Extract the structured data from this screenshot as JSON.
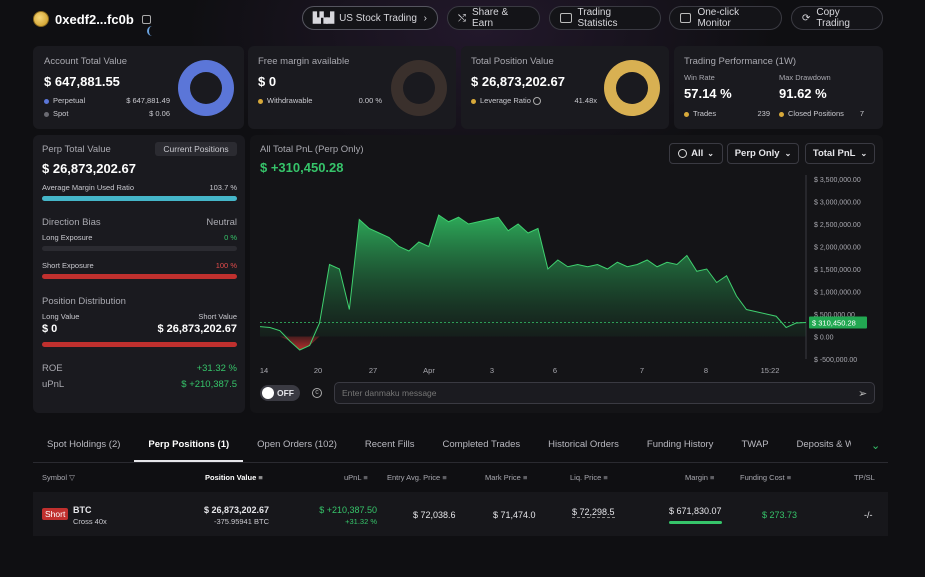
{
  "wallet": {
    "address": "0xedf2...fc0b"
  },
  "nav": {
    "us_stock": "US Stock Trading",
    "share": "Share & Earn",
    "stats": "Trading Statistics",
    "monitor": "One-click Monitor",
    "copy": "Copy Trading"
  },
  "account": {
    "title": "Account Total Value",
    "value": "$ 647,881.55",
    "perp_label": "Perpetual",
    "perp_value": "$ 647,881.49",
    "spot_label": "Spot",
    "spot_value": "$ 0.06"
  },
  "margin": {
    "title": "Free margin available",
    "value": "$ 0",
    "withdrawable_label": "Withdrawable",
    "withdrawable_value": "0.00 %"
  },
  "position": {
    "title": "Total Position Value",
    "value": "$ 26,873,202.67",
    "leverage_label": "Leverage Ratio",
    "leverage_value": "41.48x"
  },
  "performance": {
    "title": "Trading Performance (1W)",
    "win_rate_label": "Win Rate",
    "win_rate": "57.14 %",
    "drawdown_label": "Max Drawdown",
    "drawdown": "91.62 %",
    "trades_label": "Trades",
    "trades": "239",
    "closed_label": "Closed Positions",
    "closed": "7"
  },
  "perp": {
    "title": "Perp Total Value",
    "current_btn": "Current Positions",
    "value": "$ 26,873,202.67",
    "avg_margin_label": "Average Margin Used Ratio",
    "avg_margin_value": "103.7 %",
    "avg_margin_fill": 1.0,
    "bias_label": "Direction Bias",
    "bias_value": "Neutral",
    "long_exp_label": "Long Exposure",
    "long_exp_value": "0 %",
    "short_exp_label": "Short Exposure",
    "short_exp_value": "100 %",
    "dist_label": "Position Distribution",
    "long_value_label": "Long Value",
    "short_value_label": "Short Value",
    "long_value": "$ 0",
    "short_value": "$ 26,873,202.67",
    "roe_label": "ROE",
    "roe_value": "+31.32 %",
    "upnl_label": "uPnL",
    "upnl_value": "$ +210,387.5"
  },
  "pnl": {
    "title": "All Total PnL (Perp Only)",
    "value": "$ +310,450.28",
    "filter_all": "All",
    "filter_perp": "Perp Only",
    "filter_total": "Total PnL",
    "current_tag": "$ 310,450.28",
    "toggle": "OFF",
    "danmaku_placeholder": "Enter danmaku message"
  },
  "chart_data": {
    "type": "area",
    "title": "All Total PnL (Perp Only)",
    "x_ticks": [
      "14",
      "20",
      "27",
      "Apr",
      "3",
      "6",
      "7",
      "8",
      "15:22"
    ],
    "y_ticks": [
      "$ 3,500,000.00",
      "$ 3,000,000.00",
      "$ 2,500,000.00",
      "$ 2,000,000.00",
      "$ 1,500,000.00",
      "$ 1,000,000.00",
      "$ 500,000.00",
      "$ 0.00",
      "$ -500,000.00"
    ],
    "ylim": [
      -500000,
      3500000
    ],
    "y": [
      220000,
      200000,
      130000,
      -100000,
      -300000,
      -200000,
      300000,
      1600000,
      1500000,
      600000,
      2600000,
      2400000,
      2300000,
      2200000,
      2000000,
      1900000,
      2100000,
      2000000,
      2700000,
      2550000,
      2650000,
      2500000,
      2550000,
      2600000,
      2650000,
      2350000,
      2500000,
      2300000,
      2400000,
      1500000,
      1700000,
      1550000,
      1600000,
      1550000,
      1600000,
      1500000,
      1650000,
      1550000,
      1600000,
      1700000,
      1550000,
      1650000,
      1600000,
      1800000,
      1450000,
      1500000,
      1200000,
      1350000,
      900000,
      600000,
      550000,
      500000,
      450000,
      200000,
      300000,
      310450
    ],
    "current": 310450.28
  },
  "tabs": [
    "Spot Holdings (2)",
    "Perp Positions (1)",
    "Open Orders (102)",
    "Recent Fills",
    "Completed Trades",
    "Historical Orders",
    "Funding History",
    "TWAP",
    "Deposits & Withd"
  ],
  "table": {
    "headers": {
      "symbol": "Symbol",
      "position_value": "Position Value",
      "upnl": "uPnL",
      "entry": "Entry Avg. Price",
      "mark": "Mark Price",
      "liq": "Liq. Price",
      "margin": "Margin",
      "funding": "Funding Cost",
      "tpsl": "TP/SL"
    },
    "row": {
      "side": "Short",
      "symbol": "BTC",
      "mode": "Cross 40x",
      "position_value": "$ 26,873,202.67",
      "size": "-375.95941 BTC",
      "upnl": "$ +210,387.50",
      "upnl_pct": "+31.32 %",
      "entry": "$ 72,038.6",
      "mark": "$ 71,474.0",
      "liq": "$ 72,298.5",
      "margin": "$ 671,830.07",
      "funding": "$ 273.73",
      "tpsl": "-/-"
    }
  }
}
